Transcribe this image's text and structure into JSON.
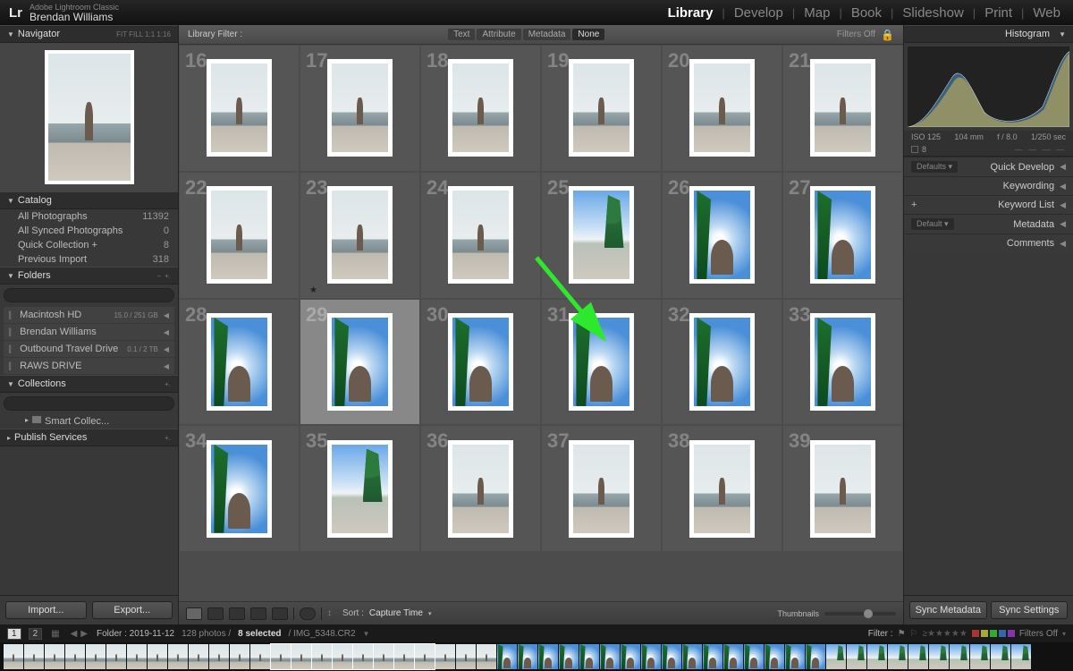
{
  "titlebar": {
    "app_small": "Adobe Lightroom Classic",
    "user": "Brendan Williams",
    "modules": [
      "Library",
      "Develop",
      "Map",
      "Book",
      "Slideshow",
      "Print",
      "Web"
    ],
    "active_module": "Library"
  },
  "left": {
    "navigator": {
      "title": "Navigator",
      "modes": [
        "FIT",
        "FILL",
        "1:1",
        "1:16"
      ]
    },
    "catalog": {
      "title": "Catalog",
      "items": [
        {
          "label": "All Photographs",
          "count": "11392"
        },
        {
          "label": "All Synced Photographs",
          "count": "0"
        },
        {
          "label": "Quick Collection  +",
          "count": "8"
        },
        {
          "label": "Previous Import",
          "count": "318"
        }
      ]
    },
    "folders": {
      "title": "Folders",
      "drives": [
        {
          "name": "Macintosh HD",
          "stat": "15.0 / 251 GB"
        },
        {
          "name": "Brendan Williams",
          "stat": ""
        },
        {
          "name": "Outbound Travel Drive",
          "stat": "0.1 / 2 TB"
        },
        {
          "name": "RAWS DRIVE",
          "stat": ""
        }
      ]
    },
    "collections": {
      "title": "Collections",
      "items": [
        {
          "label": "Smart Collec..."
        }
      ]
    },
    "publish": {
      "title": "Publish Services"
    },
    "import_btn": "Import...",
    "export_btn": "Export..."
  },
  "filterbar": {
    "label": "Library Filter :",
    "tabs": [
      "Text",
      "Attribute",
      "Metadata",
      "None"
    ],
    "filters_off": "Filters Off"
  },
  "grid": {
    "start_index": 16,
    "columns": 6,
    "rows": 4,
    "selected": [
      29
    ],
    "starred": [
      23
    ],
    "art_map": {
      "16": "sky1",
      "17": "sky1",
      "18": "sky1",
      "19": "sky1",
      "20": "sky1",
      "21": "sky1",
      "22": "sky1",
      "23": "sky1",
      "24": "sky1",
      "25": "sky2",
      "26": "sky3",
      "27": "sky3",
      "28": "sky3",
      "29": "sky3",
      "30": "sky3",
      "31": "sky3",
      "32": "sky3",
      "33": "sky3",
      "34": "sky3",
      "35": "sky2"
    }
  },
  "toolbar": {
    "sort_label": "Sort :",
    "sort_value": "Capture Time",
    "thumbnails": "Thumbnails"
  },
  "right": {
    "histogram_title": "Histogram",
    "exif": {
      "iso": "ISO 125",
      "focal": "104 mm",
      "aperture": "f / 8.0",
      "shutter": "1/250 sec"
    },
    "file_count": "8",
    "panels": [
      {
        "pill": "Defaults",
        "label": "Quick Develop"
      },
      {
        "pill": null,
        "label": "Keywording"
      },
      {
        "pill": null,
        "plus": true,
        "label": "Keyword List"
      },
      {
        "pill": "Default",
        "label": "Metadata"
      },
      {
        "pill": null,
        "label": "Comments"
      }
    ],
    "sync_meta": "Sync Metadata",
    "sync_settings": "Sync Settings"
  },
  "status": {
    "pages": [
      "1",
      "2"
    ],
    "folder": "Folder : 2019-11-12",
    "count": "128 photos /",
    "selected": "8 selected",
    "filename": "/ IMG_5348.CR2",
    "filter": "Filter :",
    "filters_off": "Filters Off"
  },
  "filmstrip": {
    "count": 50,
    "selected_start": 13,
    "selected_end": 20
  }
}
